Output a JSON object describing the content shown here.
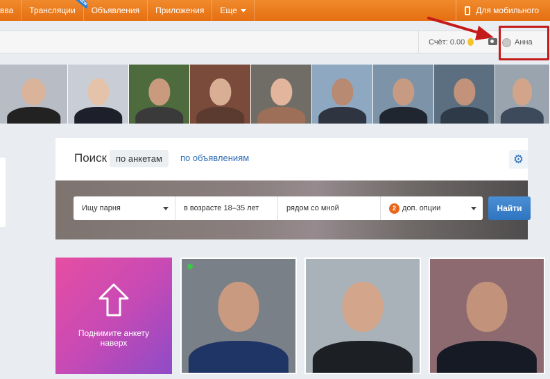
{
  "nav": {
    "items": [
      {
        "label": "вва"
      },
      {
        "label": "Трансляции",
        "badge": "NEW"
      },
      {
        "label": "Объявления"
      },
      {
        "label": "Приложения"
      },
      {
        "label": "Еще"
      }
    ],
    "mobile_label": "Для мобильного"
  },
  "subbar": {
    "balance_label": "Счёт: 0.00",
    "user_name": "Анна"
  },
  "strip": {
    "photos": [
      {
        "bg": "#b8bcc4",
        "skin": "#d9b49a",
        "cloth": "#222"
      },
      {
        "bg": "#c9ced6",
        "skin": "#e4c3aa",
        "cloth": "#1d1f2a"
      },
      {
        "bg": "#4d6b3c",
        "skin": "#c99a7d",
        "cloth": "#3a3a3a"
      },
      {
        "bg": "#7a4a3a",
        "skin": "#d8ae94",
        "cloth": "#5b3a2f"
      },
      {
        "bg": "#6f6d66",
        "skin": "#e2b59c",
        "cloth": "#9e6f58"
      },
      {
        "bg": "#8fa8c2",
        "skin": "#b88a72",
        "cloth": "#2e3440"
      },
      {
        "bg": "#7d94a8",
        "skin": "#c79b83",
        "cloth": "#1f2630"
      },
      {
        "bg": "#5b6f80",
        "skin": "#c2937a",
        "cloth": "#2f3a48"
      },
      {
        "bg": "#9aa4ae",
        "skin": "#d2a58b",
        "cloth": "#3c4a5c"
      }
    ]
  },
  "search": {
    "title": "Поиск",
    "tab_active": "по анкетам",
    "tab_link": "по объявлениям",
    "gear_icon": "gear-icon",
    "field_gender": "Ищу парня",
    "field_age": "в возрасте 18–35 лет",
    "field_location": "рядом со мной",
    "options_count": "2",
    "options_label": "доп. опции",
    "find_label": "Найти"
  },
  "cards": {
    "promo_text": "Поднимите анкету наверх",
    "profiles": [
      {
        "bg": "#7a8088",
        "skin": "#c99a80",
        "cloth": "#1f3566",
        "online": true
      },
      {
        "bg": "#a8b2b8",
        "skin": "#d3a58b",
        "cloth": "#1c1f24",
        "online": false
      },
      {
        "bg": "#8c6a70",
        "skin": "#c2927a",
        "cloth": "#151a24",
        "online": false
      }
    ]
  }
}
